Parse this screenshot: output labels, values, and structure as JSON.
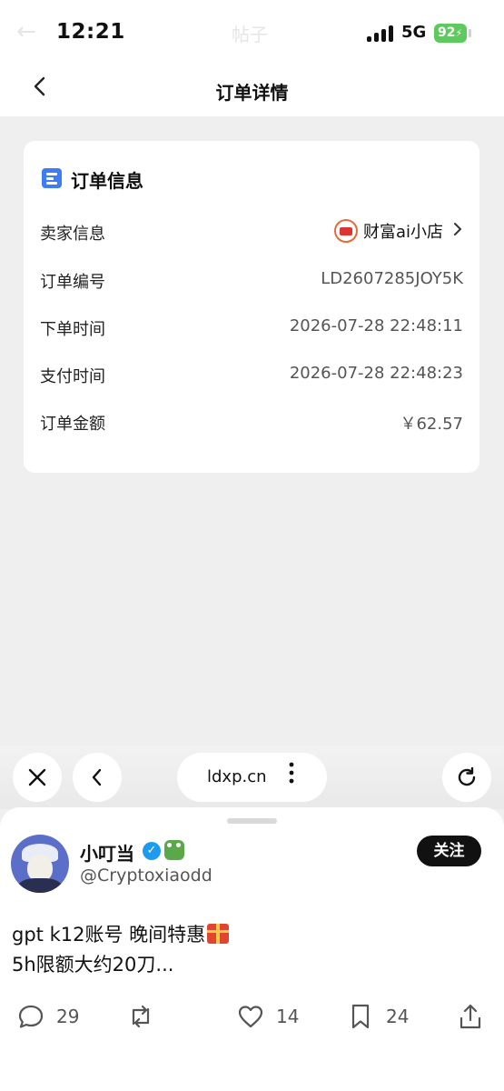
{
  "status_bar": {
    "time": "12:21",
    "network": "5G",
    "battery": "92",
    "ghost_back": "←",
    "ghost_title": "帖子"
  },
  "navbar": {
    "back_icon": "chevron-left-icon",
    "title": "订单详情"
  },
  "order_card": {
    "title": "订单信息",
    "icon": "list-doc-icon",
    "seller_label": "卖家信息",
    "seller_name": "财富ai小店",
    "rows": [
      {
        "label": "订单编号",
        "value": "LD2607285JOY5K"
      },
      {
        "label": "下单时间",
        "value": "2026-07-28 22:48:11"
      },
      {
        "label": "支付时间",
        "value": "2026-07-28 22:48:23"
      },
      {
        "label": "订单金额",
        "value": "￥62.57"
      }
    ]
  },
  "browser_bar": {
    "url": "ldxp.cn"
  },
  "tweet": {
    "display_name": "小叮当",
    "handle": "@Cryptoxiaodd",
    "follow_label": "关注",
    "text_line1": "gpt k12账号 晚间特惠",
    "text_line2": "5h限额大约20刀...",
    "replies": "29",
    "likes": "14",
    "bookmarks": "24"
  },
  "colors": {
    "accent_blue": "#3d7cf2",
    "verified": "#1d9bf0",
    "battery": "#5ec95e",
    "follow_bg": "#111111"
  }
}
